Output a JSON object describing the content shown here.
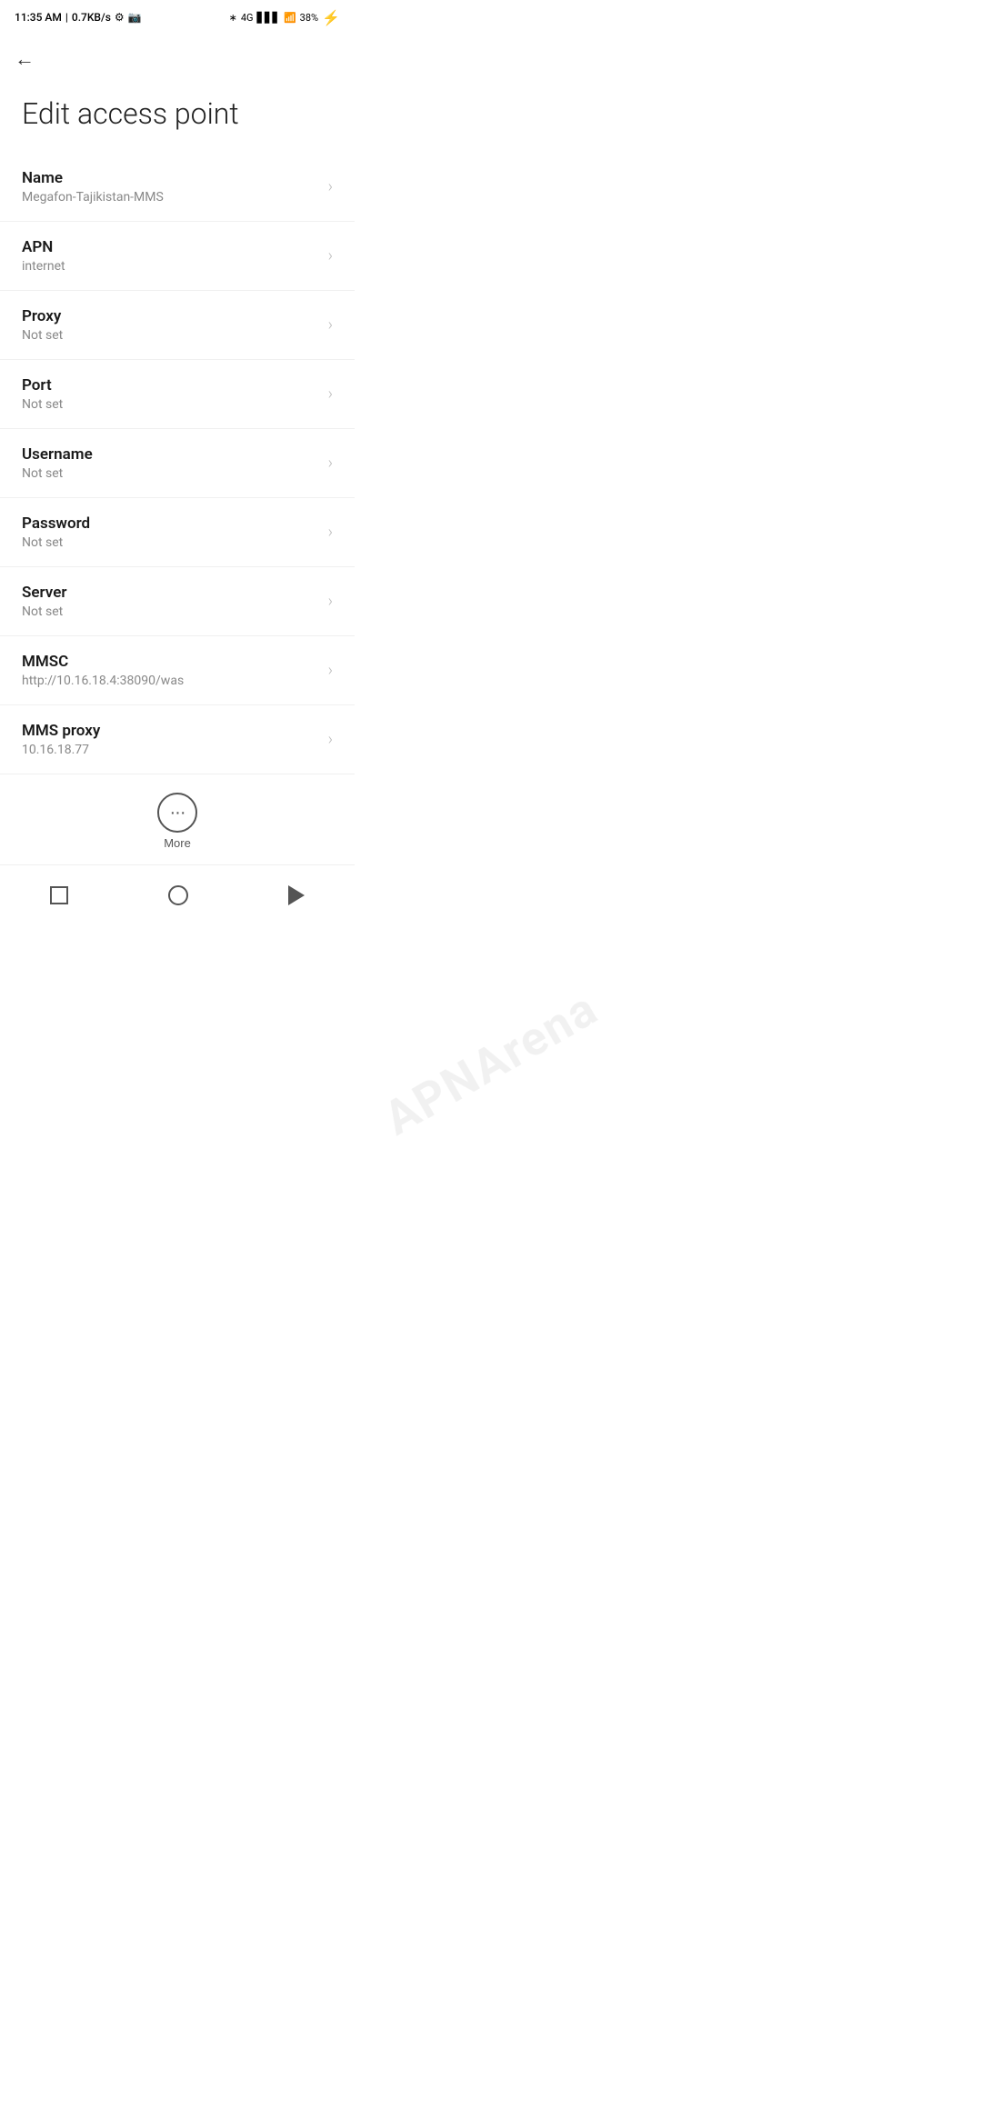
{
  "statusBar": {
    "time": "11:35 AM",
    "network": "0.7KB/s",
    "battery": "38"
  },
  "toolbar": {
    "backLabel": "←"
  },
  "page": {
    "title": "Edit access point"
  },
  "fields": [
    {
      "id": "name",
      "label": "Name",
      "value": "Megafon-Tajikistan-MMS"
    },
    {
      "id": "apn",
      "label": "APN",
      "value": "internet"
    },
    {
      "id": "proxy",
      "label": "Proxy",
      "value": "Not set"
    },
    {
      "id": "port",
      "label": "Port",
      "value": "Not set"
    },
    {
      "id": "username",
      "label": "Username",
      "value": "Not set"
    },
    {
      "id": "password",
      "label": "Password",
      "value": "Not set"
    },
    {
      "id": "server",
      "label": "Server",
      "value": "Not set"
    },
    {
      "id": "mmsc",
      "label": "MMSC",
      "value": "http://10.16.18.4:38090/was"
    },
    {
      "id": "mms-proxy",
      "label": "MMS proxy",
      "value": "10.16.18.77"
    }
  ],
  "more": {
    "label": "More",
    "icon": "···"
  },
  "watermark": "APNArena"
}
